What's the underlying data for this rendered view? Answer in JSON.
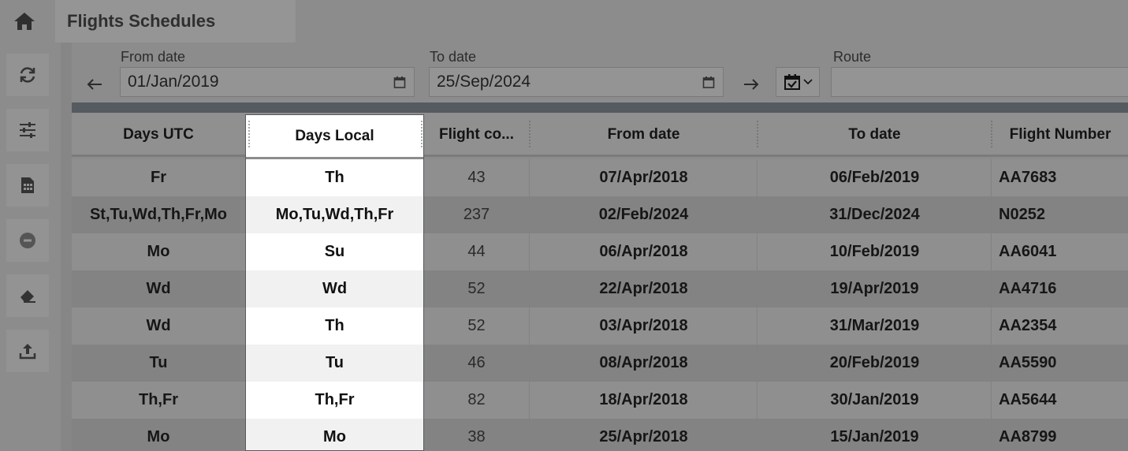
{
  "window": {
    "tab_title": "Flights Schedules"
  },
  "icons": {
    "home": "home-icon",
    "refresh": "refresh-icon",
    "filters": "sliders-icon",
    "report": "spreadsheet-icon",
    "remove": "minus-circle-icon",
    "clear": "eraser-icon",
    "export": "upload-icon",
    "calendar": "calendar-icon"
  },
  "filters": {
    "from_label": "From date",
    "from_value": "01/Jan/2019",
    "to_label": "To date",
    "to_value": "25/Sep/2024",
    "route_label": "Route",
    "route_value": ""
  },
  "table": {
    "columns": [
      "Days UTC",
      "Days Local",
      "Flight co...",
      "From date",
      "To date",
      "Flight Number"
    ],
    "rows": [
      [
        "Fr",
        "Th",
        "43",
        "07/Apr/2018",
        "06/Feb/2019",
        "AA7683"
      ],
      [
        "St,Tu,Wd,Th,Fr,Mo",
        "Mo,Tu,Wd,Th,Fr",
        "237",
        "02/Feb/2024",
        "31/Dec/2024",
        "N0252"
      ],
      [
        "Mo",
        "Su",
        "44",
        "06/Apr/2018",
        "10/Feb/2019",
        "AA6041"
      ],
      [
        "Wd",
        "Wd",
        "52",
        "22/Apr/2018",
        "19/Apr/2019",
        "AA4716"
      ],
      [
        "Wd",
        "Th",
        "52",
        "03/Apr/2018",
        "31/Mar/2019",
        "AA2354"
      ],
      [
        "Tu",
        "Tu",
        "46",
        "08/Apr/2018",
        "20/Feb/2019",
        "AA5590"
      ],
      [
        "Th,Fr",
        "Th,Fr",
        "82",
        "18/Apr/2018",
        "30/Jan/2019",
        "AA5644"
      ],
      [
        "Mo",
        "Mo",
        "38",
        "25/Apr/2018",
        "15/Jan/2019",
        "AA8799"
      ]
    ]
  },
  "colors": {
    "highlight_border": "#555b60",
    "header_band": "#555b60"
  }
}
